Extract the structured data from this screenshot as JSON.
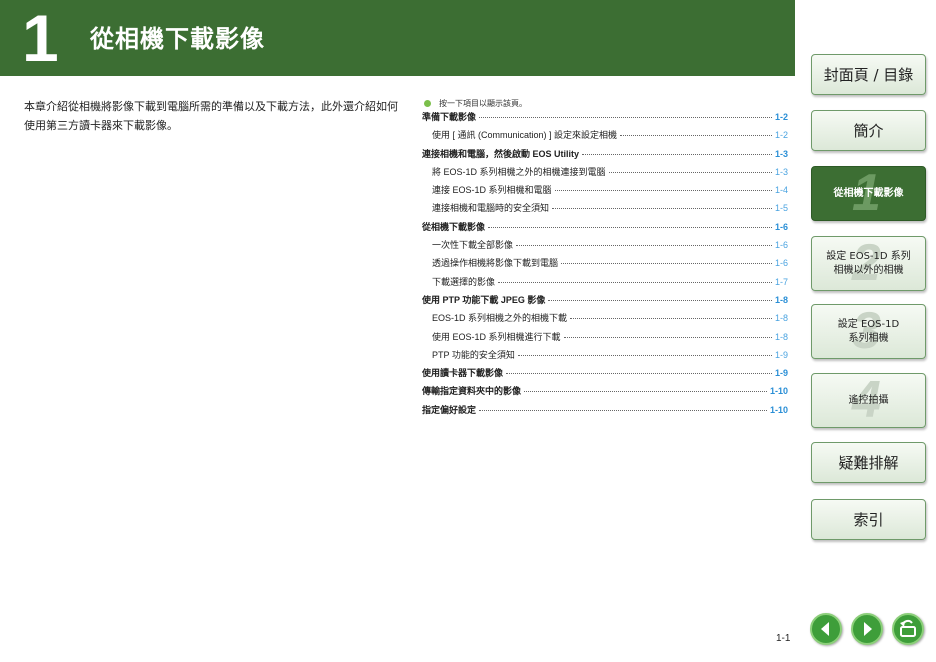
{
  "header": {
    "chapter_number": "1",
    "chapter_title": "從相機下載影像"
  },
  "intro_text": "本章介紹從相機將影像下載到電腦所需的準備以及下載方法，此外還介紹如何使用第三方讀卡器來下載影像。",
  "toc": {
    "hint": "按一下項目以顯示該頁。",
    "rows": [
      {
        "label": "準備下載影像",
        "page": "1-2",
        "level": "major"
      },
      {
        "label": "使用 [ 通訊 (Communication) ] 設定來設定相機",
        "page": "1-2",
        "level": "minor"
      },
      {
        "label": "連接相機和電腦，然後啟動 EOS Utility",
        "page": "1-3",
        "level": "major"
      },
      {
        "label": "將 EOS-1D 系列相機之外的相機連接到電腦",
        "page": "1-3",
        "level": "minor"
      },
      {
        "label": "連接 EOS-1D 系列相機和電腦",
        "page": "1-4",
        "level": "minor"
      },
      {
        "label": "連接相機和電腦時的安全須知",
        "page": "1-5",
        "level": "minor"
      },
      {
        "label": "從相機下載影像",
        "page": "1-6",
        "level": "major"
      },
      {
        "label": "一次性下載全部影像",
        "page": "1-6",
        "level": "minor"
      },
      {
        "label": "透過操作相機將影像下載到電腦",
        "page": "1-6",
        "level": "minor"
      },
      {
        "label": "下載選擇的影像",
        "page": "1-7",
        "level": "minor"
      },
      {
        "label": "使用 PTP 功能下載 JPEG 影像",
        "page": "1-8",
        "level": "major"
      },
      {
        "label": "EOS-1D 系列相機之外的相機下載",
        "page": "1-8",
        "level": "minor"
      },
      {
        "label": "使用 EOS-1D 系列相機進行下載",
        "page": "1-8",
        "level": "minor"
      },
      {
        "label": "PTP 功能的安全須知",
        "page": "1-9",
        "level": "minor"
      },
      {
        "label": "使用讀卡器下載影像",
        "page": "1-9",
        "level": "major"
      },
      {
        "label": "傳輸指定資料夾中的影像",
        "page": "1-10",
        "level": "major"
      },
      {
        "label": "指定偏好設定",
        "page": "1-10",
        "level": "major"
      }
    ]
  },
  "nav": {
    "cover": "封面頁 / 目錄",
    "intro": "簡介",
    "sec1_num": "1",
    "sec1": "從相機下載影像",
    "sec2_num": "2",
    "sec2_line1": "設定 EOS-1D 系列",
    "sec2_line2": "相機以外的相機",
    "sec3_num": "3",
    "sec3_line1": "設定 EOS-1D",
    "sec3_line2": "系列相機",
    "sec4_num": "4",
    "sec4": "遙控拍攝",
    "troubleshooting": "疑難排解",
    "index": "索引"
  },
  "footer": {
    "page_number": "1-1"
  },
  "colors": {
    "banner": "#3c6e33",
    "link_blue": "#2a8fd6",
    "nav_button_green": "#3e9e3a"
  }
}
